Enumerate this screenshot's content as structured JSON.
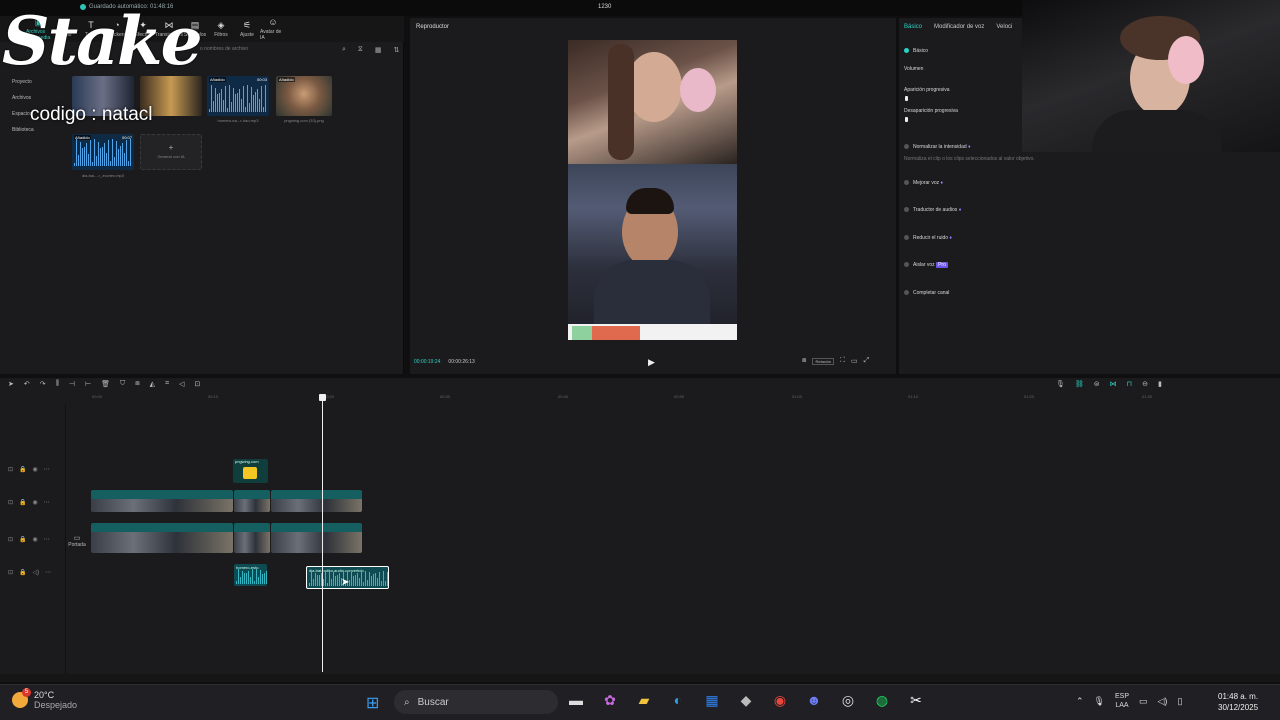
{
  "titlebar": {
    "autosave": "Guardado automático: 01:48:16",
    "center": "1230"
  },
  "toolbar": {
    "items": [
      {
        "label": "Archivos multimedia",
        "icon": "media-icon"
      },
      {
        "label": "Audio",
        "icon": "audio-icon"
      },
      {
        "label": "Texto",
        "icon": "text-icon"
      },
      {
        "label": "Stickers",
        "icon": "sticker-icon"
      },
      {
        "label": "Efectos",
        "icon": "effects-icon"
      },
      {
        "label": "Transiciones",
        "icon": "transition-icon"
      },
      {
        "label": "Subtítulos",
        "icon": "subtitles-icon"
      },
      {
        "label": "Filtros",
        "icon": "filter-icon"
      },
      {
        "label": "Ajuste",
        "icon": "adjust-icon"
      },
      {
        "label": "Avatar de IA",
        "icon": "ai-avatar-icon"
      }
    ]
  },
  "media": {
    "search_placeholder": "o nombres de archivo",
    "sidebar": [
      "Proyecto",
      "Archivos",
      "Espacios",
      "Biblioteca"
    ],
    "items": [
      {
        "tag": "Añadido",
        "duration": "00:03",
        "label": "homero-ea...r-hao.mp3",
        "type": "audio"
      },
      {
        "tag": "Añadido",
        "duration": "",
        "label": "pngwing.com (33).png",
        "type": "image"
      },
      {
        "tag": "Añadido",
        "duration": "00:07",
        "label": "dia-bai-...r_zvortex.mp3",
        "type": "audio"
      },
      {
        "tag": "",
        "duration": "",
        "label": "Generar con IA",
        "type": "generate"
      }
    ]
  },
  "overlay": {
    "logo": "Stake",
    "code": "codigo : natacl"
  },
  "player": {
    "title": "Reproductor",
    "current_time": "00:00:19:24",
    "total_time": "00:00:26:13",
    "ratio_label": "Relación"
  },
  "props": {
    "tabs": [
      "Básico",
      "Modificador de voz",
      "Veloci"
    ],
    "section": "Básico",
    "volume": "Volumen",
    "fade_in": "Aparición progresiva",
    "fade_out": "Desaparición progresiva",
    "normalize": "Normalizar la intensidad",
    "normalize_desc": "Normaliza el clip o los clips seleccionados al valor objetivo.",
    "enhance": "Mejorar voz",
    "translator": "Traductor de audios",
    "noise": "Reducir el ruido",
    "isolate": "Aislar voz",
    "isolate_badge": "Pro",
    "complete": "Completar canal"
  },
  "timeline": {
    "ruler": [
      "00:00",
      "00:10",
      "00:20",
      "00:30",
      "00:40",
      "00:50",
      "01:00",
      "01:10",
      "01:20",
      "01:30"
    ],
    "cover_label": "Portada",
    "clips": {
      "sticker": "pngwing.com",
      "video1a": "clip_0YKOFUI08TWOC0YE7Y0335Y9.mp4  00:00:12:07",
      "video1b": "clip_0YKOFUI0",
      "video1c": "clip_0YKOFUI08TWOC0YE7Y0D335Y9",
      "video2a": "clip_0YKOFUI08TWOC0YE7Y0335Y9.mp4  00:00:12:07",
      "video2b": "Efectos vo",
      "video2c": "clip_0YKOFUI08TWOC0YE7Y0D335Y9",
      "audio1": "homero-estu",
      "audio2": "dia-bai-poliko-audio-convertido"
    }
  },
  "taskbar": {
    "temp": "20°C",
    "weather": "Despejado",
    "weather_badge": "5",
    "search": "Buscar",
    "lang_top": "ESP",
    "lang_bottom": "LAA",
    "time": "01:48 a. m.",
    "date": "30/12/2025"
  },
  "colors": {
    "accent": "#2bd3c5",
    "video_clip": "#155f60",
    "audio_clip": "#0e4b52"
  }
}
